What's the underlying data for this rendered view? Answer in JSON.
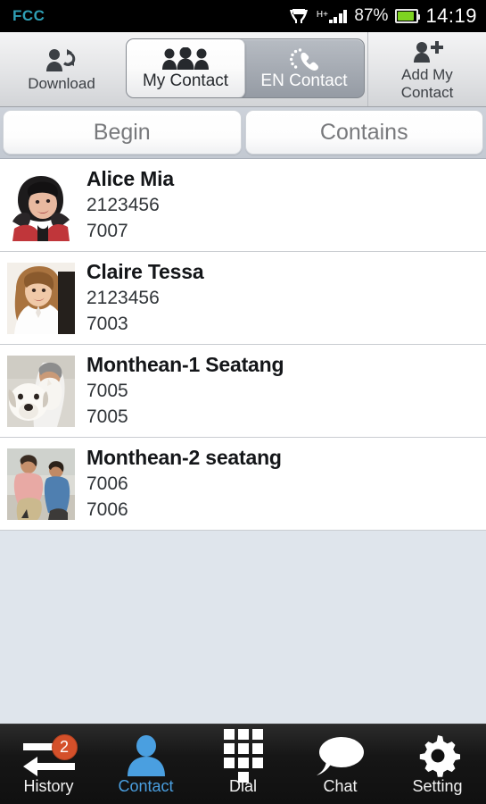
{
  "status_bar": {
    "brand": "FCC",
    "network_type": "H+",
    "battery_percent": "87%",
    "battery_level": 87,
    "clock": "14:19",
    "icons": [
      "vpn-icon",
      "signal-bars-icon",
      "battery-icon"
    ]
  },
  "toolbar": {
    "download_label": "Download",
    "add_contact_label": "Add My\nContact",
    "add_contact_line1": "Add My",
    "add_contact_line2": "Contact",
    "segments": [
      {
        "label": "My Contact",
        "icon": "group-people-icon",
        "active": true
      },
      {
        "label": "EN Contact",
        "icon": "phone-handset-icon",
        "active": false
      }
    ]
  },
  "filters": {
    "begin_label": "Begin",
    "contains_label": "Contains"
  },
  "contacts": [
    {
      "name": "Alice Mia",
      "phone": "2123456",
      "extension": "7007",
      "avatar": "photo-woman-hat"
    },
    {
      "name": "Claire Tessa",
      "phone": "2123456",
      "extension": "7003",
      "avatar": "photo-woman-long-hair"
    },
    {
      "name": "Monthean-1 Seatang",
      "phone": "7005",
      "extension": "7005",
      "avatar": "photo-man-dog"
    },
    {
      "name": "Monthean-2 seatang",
      "phone": "7006",
      "extension": "7006",
      "avatar": "photo-man-child"
    }
  ],
  "bottom_nav": [
    {
      "label": "History",
      "icon": "exchange-arrows-icon",
      "badge": "2",
      "active": false
    },
    {
      "label": "Contact",
      "icon": "person-icon",
      "badge": null,
      "active": true
    },
    {
      "label": "Dial",
      "icon": "dialpad-icon",
      "badge": null,
      "active": false
    },
    {
      "label": "Chat",
      "icon": "speech-bubble-icon",
      "badge": null,
      "active": false
    },
    {
      "label": "Setting",
      "icon": "gear-icon",
      "badge": null,
      "active": false
    }
  ],
  "colors": {
    "status_bar_bg": "#000000",
    "brand_text": "#2f9fb5",
    "battery_fill": "#7ed321",
    "active_tab_text": "#4a9fe0",
    "badge_bg": "#d4502a",
    "list_empty_bg": "#dfe5ec",
    "tabbar_bg": "#101010"
  }
}
